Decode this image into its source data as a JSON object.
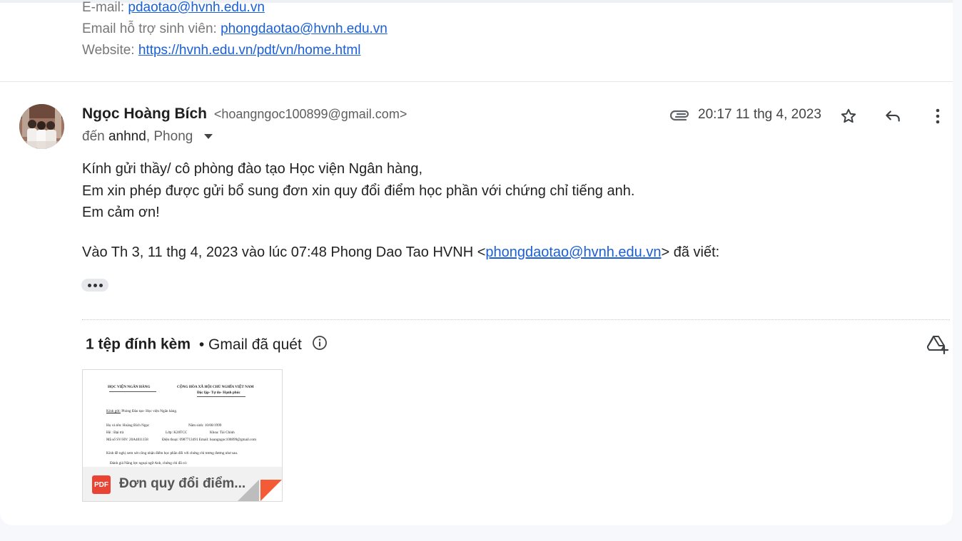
{
  "previous_email": {
    "email_label": "E-mail:",
    "email_value": "pdaotao@hvnh.edu.vn",
    "support_label": "Email hỗ trợ sinh viên:",
    "support_value": "phongdaotao@hvnh.edu.vn",
    "website_label": "Website:",
    "website_value": "https://hvnh.edu.vn/pdt/vn/home.html"
  },
  "message": {
    "sender_name": "Ngọc Hoàng Bích",
    "sender_email": "<hoangngoc100899@gmail.com>",
    "to_prefix": "đến",
    "to_first": "anhnd",
    "to_rest": ", Phong",
    "timestamp": "20:17 11 thg 4, 2023",
    "body_lines": [
      "Kính gửi thầy/ cô phòng đào tạo Học viện Ngân hàng,",
      "Em xin phép được gửi bổ sung đơn xin quy đổi điểm học phần với chứng chỉ tiếng anh.",
      "Em cảm ơn!"
    ],
    "quote_prefix": "Vào Th 3, 11 thg 4, 2023 vào lúc 07:48 Phong Dao Tao HVNH <",
    "quote_email": "phongdaotao@hvnh.edu.vn",
    "quote_suffix": "> đã viết:"
  },
  "attachments": {
    "count_label": "1 tệp đính kèm",
    "scan_label": "• Gmail đã quét",
    "file_name": "Đơn quy đổi điểm...",
    "file_type": "PDF",
    "preview": {
      "org": "HỌC VIỆN NGÂN HÀNG",
      "nation": "CỘNG HÒA XÃ HỘI CHỦ NGHĨA VIỆT NAM",
      "motto": "Độc lập- Tự do- Hạnh phúc",
      "to_label": "Kính gửi:",
      "to_text": "Phòng Đào tạo- Học viện Ngân hàng.",
      "name": "Họ và tên: Hoàng Bích Ngọc",
      "dob": "Năm sinh: 10/08/1999",
      "system": "Hệ : Đại trà",
      "class": "Lớp: K20TCC",
      "faculty": "Khoa: Tài Chính",
      "student_id": "Mã số SV/HV: 20A4011158",
      "phone": "Điện thoại: 0987713491 Email: hoangngoc100899@gmail.com",
      "request": "Kính đề nghị xem xét công nhận điểm học phần đối với chứng chỉ tương đương như sau.",
      "item": "Đánh giá Năng lực ngoại ngữ Anh, chứng chỉ đã có:"
    }
  },
  "colors": {
    "link": "#1a5fd8",
    "pdf_red": "#e94335",
    "background": "#f6f8fc"
  }
}
